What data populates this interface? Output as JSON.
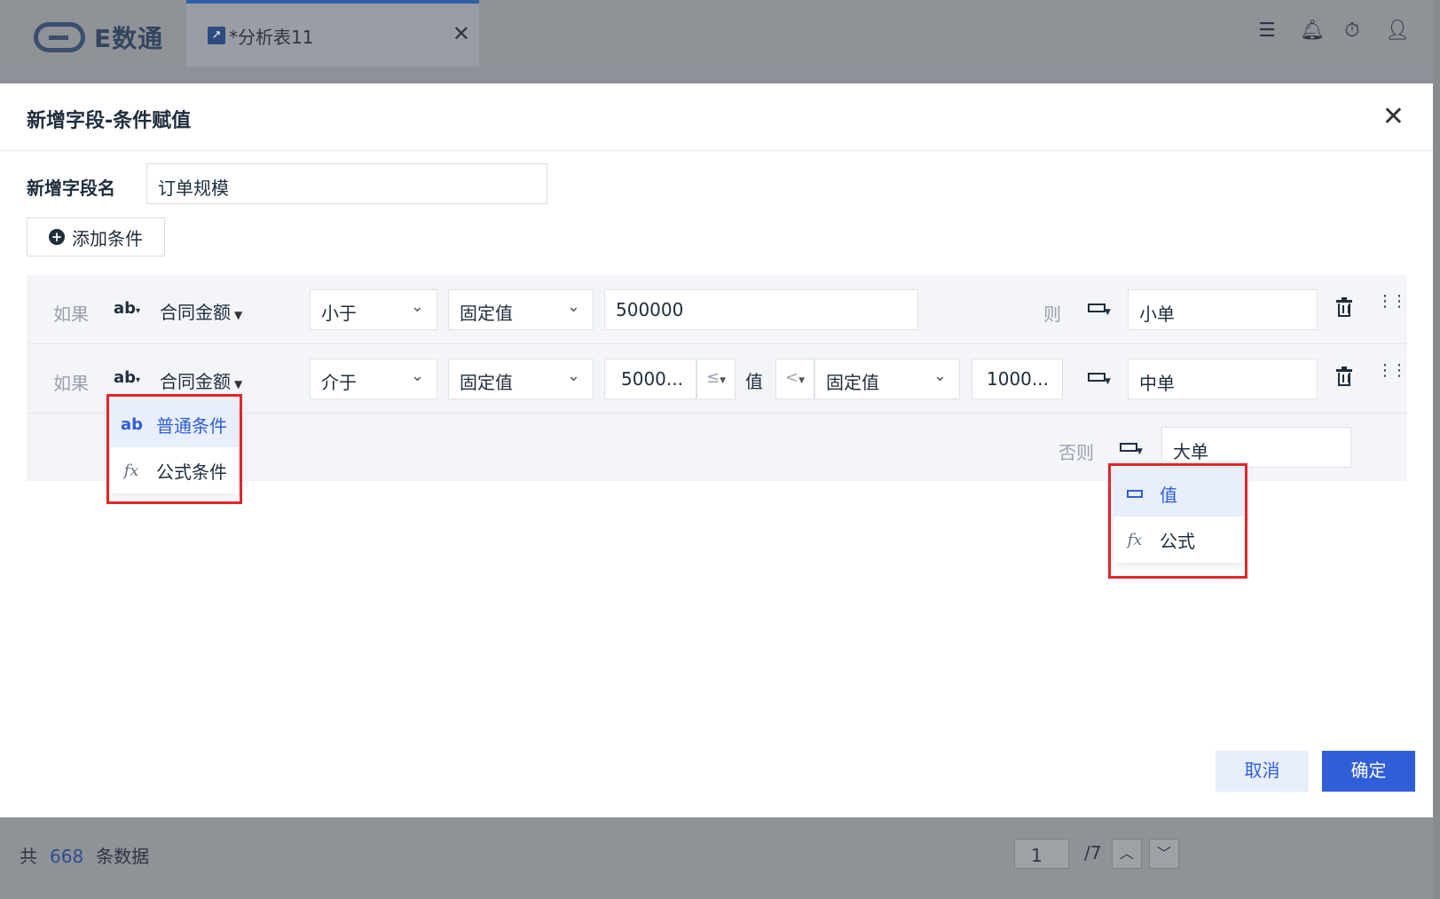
{
  "app": {
    "logo_text": "E数通",
    "tab_label": "*分析表11",
    "tab_close": "✕",
    "top_icons": [
      "list-check-icon",
      "bell-icon",
      "timer-icon",
      "user-icon"
    ]
  },
  "footer": {
    "count_prefix": "共",
    "count": "668",
    "count_suffix": "条数据",
    "page_current": "1",
    "page_total": "/7"
  },
  "modal": {
    "title": "新增字段-条件赋值",
    "field_label": "新增字段名",
    "field_value": "订单规模",
    "add_condition": "添加条件",
    "conditions": [
      {
        "if_label": "如果",
        "type_icon": "ab",
        "field": "合同金额",
        "operator": "小于",
        "value_type": "固定值",
        "value": "500000",
        "then_label": "则",
        "result": "小单"
      },
      {
        "if_label": "如果",
        "type_icon": "ab",
        "field": "合同金额",
        "operator": "介于",
        "value_type": "固定值",
        "value_low": "5000...",
        "op_low": "≤",
        "mid_label": "值",
        "op_high": "<",
        "value_type_high": "固定值",
        "value_high": "1000...",
        "then_label": "则",
        "result": "中单"
      }
    ],
    "else_label": "否则",
    "else_result": "大单",
    "condition_type_menu": [
      {
        "icon": "ab",
        "label": "普通条件",
        "active": true
      },
      {
        "icon": "fx",
        "label": "公式条件",
        "active": false
      }
    ],
    "result_type_menu": [
      {
        "icon": "value-box-icon",
        "label": "值",
        "active": true
      },
      {
        "icon": "fx",
        "label": "公式",
        "active": false
      }
    ],
    "cancel_label": "取消",
    "ok_label": "确定"
  },
  "colors": {
    "primary": "#2f5ed6",
    "highlight_box": "#e0262b",
    "overlay": "#8e9198"
  }
}
